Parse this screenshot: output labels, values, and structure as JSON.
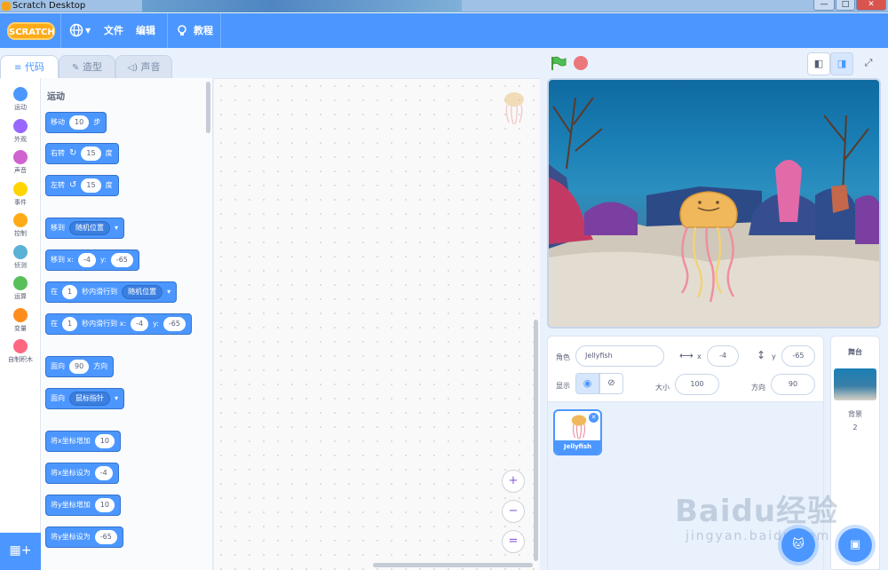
{
  "window": {
    "title": "Scratch Desktop",
    "min": "—",
    "max": "□",
    "close": "✕"
  },
  "menubar": {
    "logo": "SCRATCH",
    "file": "文件",
    "edit": "编辑",
    "tutorials": "教程",
    "language_icon": "globe-icon"
  },
  "tabs": [
    {
      "label": "代码"
    },
    {
      "label": "造型"
    },
    {
      "label": "声音"
    }
  ],
  "categories": [
    {
      "label": "运动",
      "color": "#4c97ff"
    },
    {
      "label": "外观",
      "color": "#9966ff"
    },
    {
      "label": "声音",
      "color": "#cf63cf"
    },
    {
      "label": "事件",
      "color": "#ffd500"
    },
    {
      "label": "控制",
      "color": "#ffab19"
    },
    {
      "label": "侦测",
      "color": "#5cb1d6"
    },
    {
      "label": "运算",
      "color": "#59c059"
    },
    {
      "label": "变量",
      "color": "#ff8c1a"
    },
    {
      "label": "自制积木",
      "color": "#ff6680"
    }
  ],
  "palette": {
    "section": "运动",
    "blocks": [
      {
        "a": "移动",
        "v": "10",
        "b": "步"
      },
      {
        "a": "右转",
        "v": "15",
        "b": "度"
      },
      {
        "a": "左转",
        "v": "15",
        "b": "度"
      },
      {
        "a": "移到",
        "dd": "随机位置"
      },
      {
        "a": "移到 x:",
        "v": "-4",
        "b": "y:",
        "v2": "-65"
      },
      {
        "a": "在",
        "v": "1",
        "b": "秒内滑行到",
        "dd": "随机位置"
      },
      {
        "a": "在",
        "v": "1",
        "b": "秒内滑行到 x:",
        "v2": "-4",
        "c": "y:",
        "v3": "-65"
      },
      {
        "a": "面向",
        "v": "90",
        "b": "方向"
      },
      {
        "a": "面向",
        "dd": "鼠标指针"
      },
      {
        "a": "将x坐标增加",
        "v": "10"
      },
      {
        "a": "将x坐标设为",
        "v": "-4"
      },
      {
        "a": "将y坐标增加",
        "v": "10"
      },
      {
        "a": "将y坐标设为",
        "v": "-65"
      }
    ]
  },
  "zoom": {
    "in": "+",
    "out": "−",
    "reset": "="
  },
  "sprite_info": {
    "sprite_label": "角色",
    "sprite_name": "Jellyfish",
    "x_label": "x",
    "x": "-4",
    "y_label": "y",
    "y": "-65",
    "show_label": "显示",
    "size_label": "大小",
    "size": "100",
    "direction_label": "方向",
    "direction": "90"
  },
  "sprites": [
    {
      "name": "Jellyfish"
    }
  ],
  "stage_pane": {
    "title": "舞台",
    "backdrops_label": "背景",
    "backdrops_count": "2"
  },
  "watermark": {
    "main": "Baidu经验",
    "sub": "jingyan.baidu.com"
  }
}
